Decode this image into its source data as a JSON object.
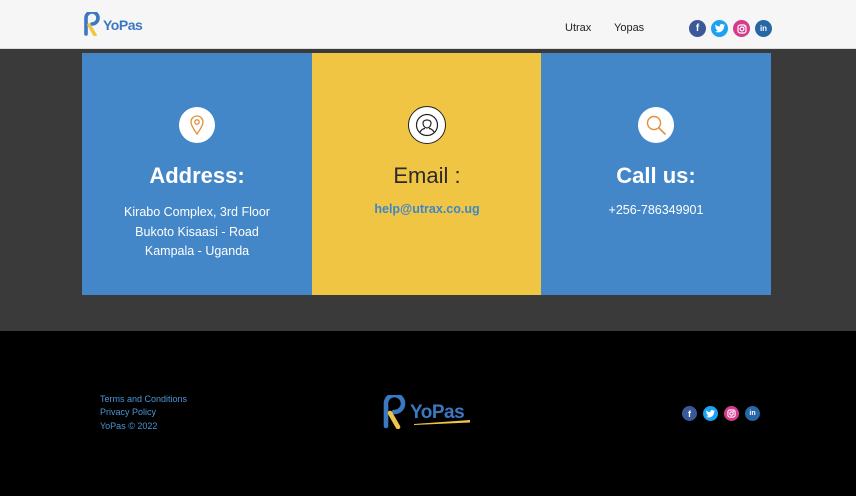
{
  "header": {
    "logo_text": "YoPas",
    "nav": [
      "Utrax",
      "Yopas"
    ],
    "socials": [
      "facebook-icon",
      "twitter-icon",
      "instagram-icon",
      "linkedin-icon"
    ]
  },
  "cards": {
    "address": {
      "icon": "location-pin-icon",
      "title": "Address:",
      "lines": [
        "Kirabo Complex, 3rd Floor",
        "Bukoto Kisaasi - Road",
        "Kampala - Uganda"
      ]
    },
    "email": {
      "icon": "user-icon",
      "title": "Email :",
      "link": "help@utrax.co.ug"
    },
    "call": {
      "icon": "search-icon",
      "title": "Call us:",
      "phone": "+256-786349901"
    }
  },
  "footer": {
    "links": [
      "Terms and Conditions",
      "Privacy Policy",
      "YoPas © 2022"
    ],
    "logo_text": "YoPas"
  },
  "colors": {
    "blue_card": "#4487c9",
    "yellow_card": "#f1c544",
    "brand_blue": "#3a78c2",
    "brand_yellow": "#f1c544"
  }
}
